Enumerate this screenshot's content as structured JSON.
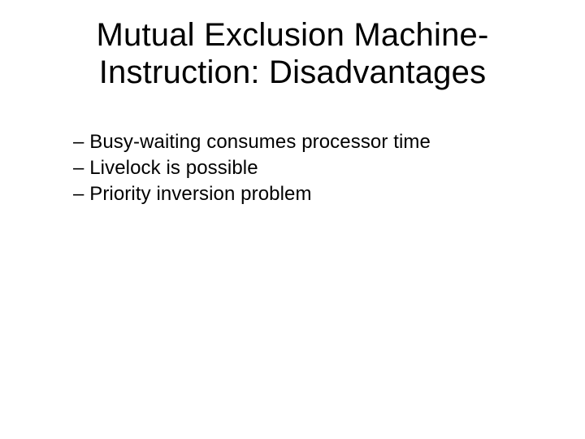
{
  "slide": {
    "title_line1": "Mutual Exclusion Machine-",
    "title_line2": "Instruction: Disadvantages",
    "bullets": [
      "– Busy-waiting consumes processor time",
      "– Livelock is possible",
      "– Priority inversion problem"
    ]
  }
}
